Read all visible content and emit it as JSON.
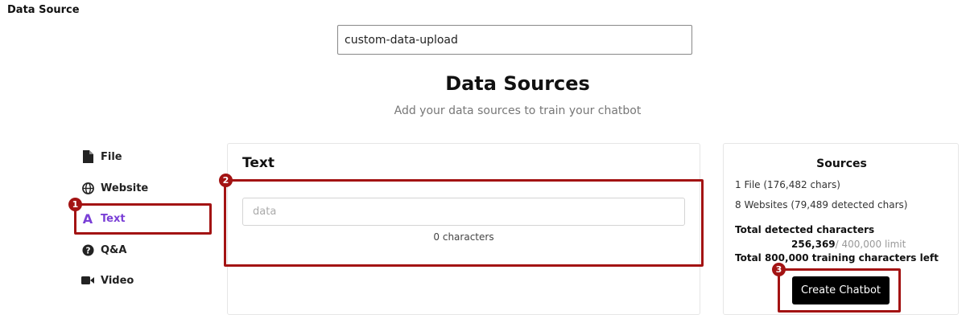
{
  "header": {
    "page_label": "Data Source",
    "name_value": "custom-data-upload"
  },
  "intro": {
    "title": "Data Sources",
    "subtitle": "Add your data sources to train your chatbot"
  },
  "sidebar": {
    "items": [
      {
        "label": "File",
        "icon": "file-icon",
        "active": false
      },
      {
        "label": "Website",
        "icon": "globe-icon",
        "active": false
      },
      {
        "label": "Text",
        "icon": "text-icon",
        "active": true
      },
      {
        "label": "Q&A",
        "icon": "question-icon",
        "active": false
      },
      {
        "label": "Video",
        "icon": "video-icon",
        "active": false
      }
    ]
  },
  "text_panel": {
    "title": "Text",
    "input_value": "",
    "input_placeholder": "data",
    "char_count": "0 characters"
  },
  "sources_panel": {
    "title": "Sources",
    "files_line": "1 File (176,482 chars)",
    "websites_line": "8 Websites (79,489 detected chars)",
    "total_detected_label": "Total detected characters",
    "detected_count": "256,369",
    "detected_limit": "/ 400,000 limit",
    "training_left": "Total 800,000 training characters left",
    "create_button": "Create Chatbot"
  },
  "annotations": [
    "1",
    "2",
    "3"
  ],
  "colors": {
    "accent": "#7a3fd6",
    "annotation": "#a31313",
    "button_bg": "#000000"
  }
}
